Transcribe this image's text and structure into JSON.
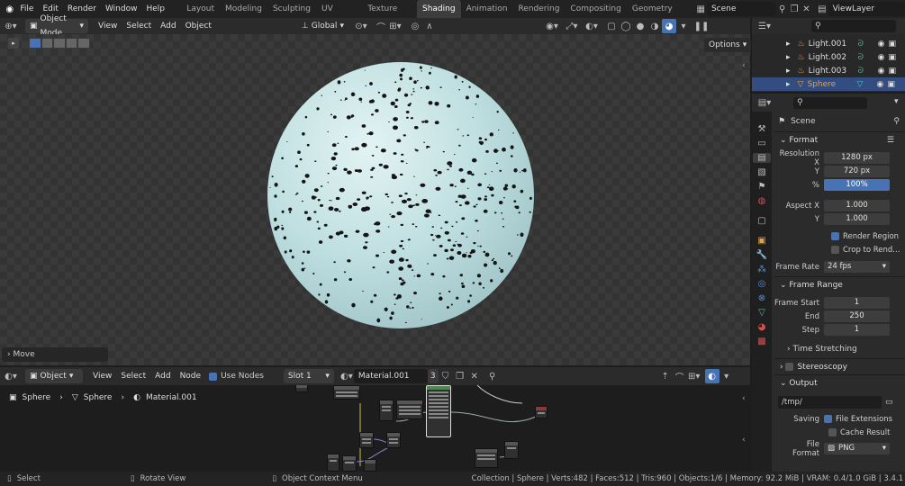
{
  "menubar": {
    "items": [
      "File",
      "Edit",
      "Render",
      "Window",
      "Help"
    ],
    "workspaces": [
      "Layout",
      "Modeling",
      "Sculpting",
      "UV Editing",
      "Texture Paint",
      "Shading",
      "Animation",
      "Rendering",
      "Compositing",
      "Geometry Node"
    ],
    "active_workspace": "Shading",
    "scene": "Scene",
    "view_layer": "ViewLayer"
  },
  "viewport": {
    "mode": "Object Mode",
    "menus": [
      "View",
      "Select",
      "Add",
      "Object"
    ],
    "orientation": "Global",
    "options": "Options",
    "last_op": "Move"
  },
  "node_editor": {
    "type": "Object",
    "menus": [
      "View",
      "Select",
      "Add",
      "Node"
    ],
    "use_nodes": "Use Nodes",
    "slot": "Slot 1",
    "material": "Material.001",
    "users": "3",
    "breadcrumb": [
      "Sphere",
      "Sphere",
      "Material.001"
    ]
  },
  "outliner": {
    "rows": [
      {
        "name": "Light.001"
      },
      {
        "name": "Light.002"
      },
      {
        "name": "Light.003"
      },
      {
        "name": "Sphere",
        "selected": true
      }
    ]
  },
  "properties": {
    "context": "Scene",
    "format": {
      "title": "Format",
      "res_x_label": "Resolution X",
      "res_x": "1280 px",
      "res_y_label": "Y",
      "res_y": "720 px",
      "pct_label": "%",
      "pct": "100%",
      "aspect_x_label": "Aspect X",
      "aspect_x": "1.000",
      "aspect_y_label": "Y",
      "aspect_y": "1.000",
      "render_region": "Render Region",
      "crop": "Crop to Rend...",
      "frame_rate_label": "Frame Rate",
      "frame_rate": "24 fps"
    },
    "frame_range": {
      "title": "Frame Range",
      "start_label": "Frame Start",
      "start": "1",
      "end_label": "End",
      "end": "250",
      "step_label": "Step",
      "step": "1"
    },
    "time_stretching": "Time Stretching",
    "stereoscopy": "Stereoscopy",
    "output": {
      "title": "Output",
      "path": "/tmp/",
      "saving_label": "Saving",
      "file_ext": "File Extensions",
      "cache": "Cache Result",
      "format_label": "File Format",
      "format": "PNG"
    }
  },
  "statusbar": {
    "select": "Select",
    "rotate": "Rotate View",
    "context_menu": "Object Context Menu",
    "stats": "Collection | Sphere | Verts:482 | Faces:512 | Tris:960 | Objects:1/6 | Memory: 92.2 MiB | VRAM: 0.4/1.0 GiB | 3.4.1"
  },
  "colors": {
    "accent": "#4772b3",
    "sphere": "#c5e3e4",
    "selected_row": "#334d80"
  }
}
